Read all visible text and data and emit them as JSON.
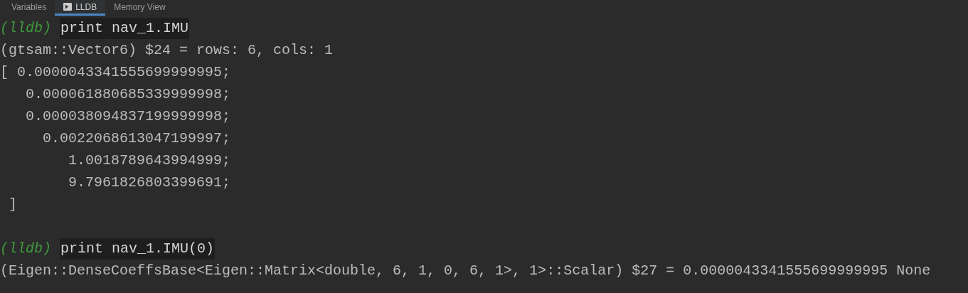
{
  "tabs": [
    {
      "label": "Variables",
      "selected": false,
      "icon": false
    },
    {
      "label": "LLDB",
      "selected": true,
      "icon": true
    },
    {
      "label": "Memory View",
      "selected": false,
      "icon": false
    }
  ],
  "console": [
    {
      "kind": "prompt",
      "prompt": "(lldb)",
      "command": "print nav_1.IMU"
    },
    {
      "kind": "output",
      "text": "(gtsam::Vector6) $24 = rows: 6, cols: 1"
    },
    {
      "kind": "output",
      "text": "[ 0.0000043341555699999995;"
    },
    {
      "kind": "output",
      "text": "   0.000061880685339999998;"
    },
    {
      "kind": "output",
      "text": "   0.000038094837199999998;"
    },
    {
      "kind": "output",
      "text": "     0.0022068613047199997;"
    },
    {
      "kind": "output",
      "text": "        1.0018789643994999;"
    },
    {
      "kind": "output",
      "text": "        9.7961826803399691;"
    },
    {
      "kind": "output",
      "text": " ]"
    },
    {
      "kind": "blank"
    },
    {
      "kind": "prompt",
      "prompt": "(lldb)",
      "command": "print nav_1.IMU(0)"
    },
    {
      "kind": "output",
      "text": "(Eigen::DenseCoeffsBase<Eigen::Matrix<double, 6, 1, 0, 6, 1>, 1>::Scalar) $27 = 0.0000043341555699999995 None"
    }
  ]
}
